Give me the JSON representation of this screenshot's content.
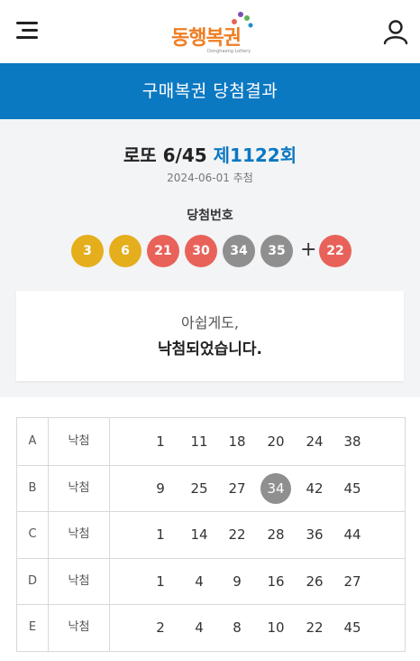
{
  "header": {
    "logo_text": "동행복권",
    "logo_sub": "Donghaeng Lottery",
    "icons": [
      "menu-icon",
      "user-icon"
    ]
  },
  "title_bar": "구매복권 당첨결과",
  "draw": {
    "game_name": "로또 6/45",
    "round": "제1122회",
    "date": "2024-06-01 추첨"
  },
  "winning": {
    "label": "당첨번호",
    "numbers": [
      "3",
      "6",
      "21",
      "30",
      "34",
      "35"
    ],
    "plus": "+",
    "bonus": "22",
    "colors": {
      "yellow": "#e4ae1c",
      "red": "#e8625a",
      "gray": "#8f8f8f",
      "brand_blue": "#0b78c2",
      "logo_orange": "#ef7d22"
    }
  },
  "message": {
    "line1": "아쉽게도,",
    "line2": "낙첨되었습니다."
  },
  "tickets": [
    {
      "game": "A",
      "result": "낙첨",
      "numbers": [
        "1",
        "11",
        "18",
        "20",
        "24",
        "38"
      ],
      "hits": []
    },
    {
      "game": "B",
      "result": "낙첨",
      "numbers": [
        "9",
        "25",
        "27",
        "34",
        "42",
        "45"
      ],
      "hits": [
        3
      ]
    },
    {
      "game": "C",
      "result": "낙첨",
      "numbers": [
        "1",
        "14",
        "22",
        "28",
        "36",
        "44"
      ],
      "hits": []
    },
    {
      "game": "D",
      "result": "낙첨",
      "numbers": [
        "1",
        "4",
        "9",
        "16",
        "26",
        "27"
      ],
      "hits": []
    },
    {
      "game": "E",
      "result": "낙첨",
      "numbers": [
        "2",
        "4",
        "8",
        "10",
        "22",
        "45"
      ],
      "hits": []
    }
  ]
}
